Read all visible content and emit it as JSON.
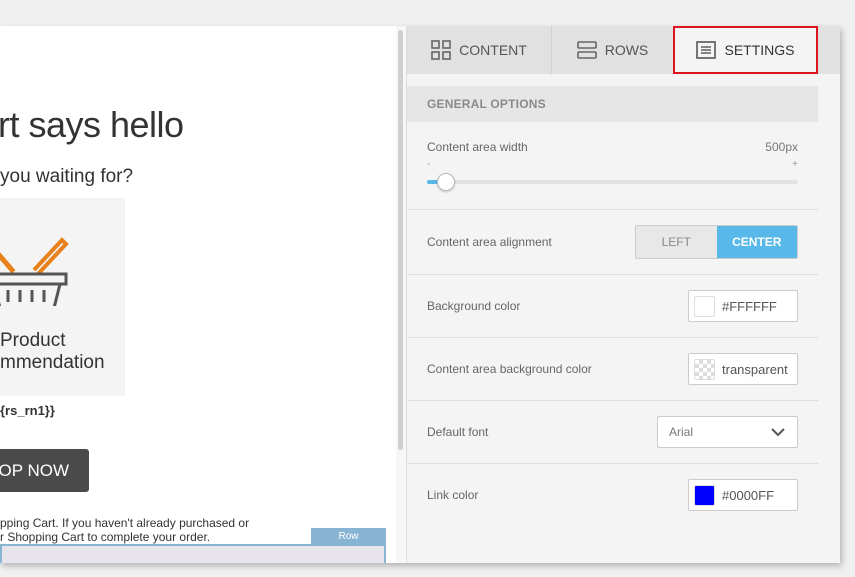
{
  "canvas": {
    "headline": "rt says hello",
    "subline": "you waiting for?",
    "product_line1": "Product",
    "product_line2": "mmendation",
    "placeholder": "{rs_rn1}}",
    "shop_button": "OP NOW",
    "cart_line1": "pping Cart. If you haven't already purchased or",
    "cart_line2": "r Shopping Cart to complete your order.",
    "row_tag": "Row",
    "accent_color": "#e8811c"
  },
  "tabs": [
    {
      "label": "CONTENT",
      "icon": "grid-icon"
    },
    {
      "label": "ROWS",
      "icon": "rows-icon"
    },
    {
      "label": "SETTINGS",
      "icon": "document-icon",
      "active": true
    }
  ],
  "general_options": {
    "title": "GENERAL OPTIONS",
    "width": {
      "label": "Content area width",
      "value": "500px",
      "min_label": "-",
      "max_label": "+",
      "fraction": 0.05
    },
    "alignment": {
      "label": "Content area alignment",
      "options": [
        "LEFT",
        "CENTER"
      ],
      "selected": "CENTER"
    },
    "background_color": {
      "label": "Background color",
      "value": "#FFFFFF",
      "swatch": "#FFFFFF"
    },
    "content_bg_color": {
      "label": "Content area background color",
      "value": "transparent"
    },
    "default_font": {
      "label": "Default font",
      "value": "Arial"
    },
    "link_color": {
      "label": "Link color",
      "value": "#0000FF",
      "swatch": "#0000FF"
    }
  }
}
